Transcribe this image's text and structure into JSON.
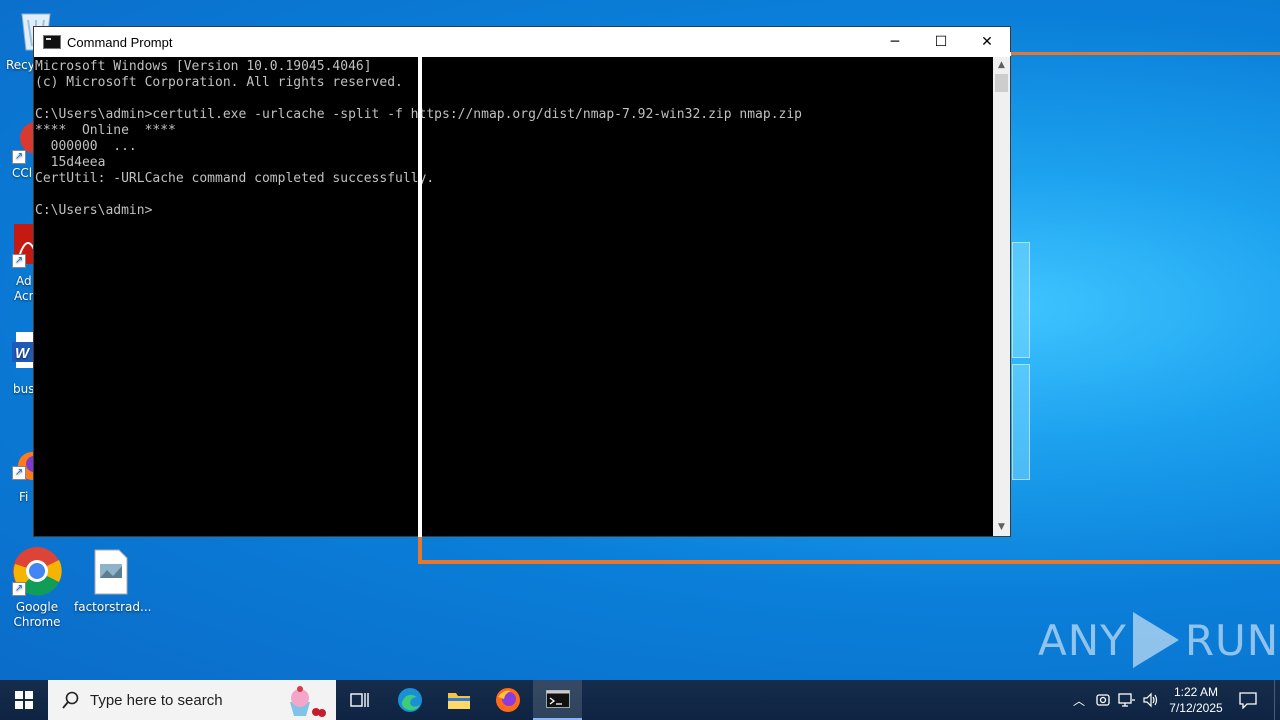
{
  "desktop": {
    "icons": [
      {
        "label": "Recy",
        "icon": "recycle-bin-icon"
      },
      {
        "label": "CCl",
        "icon": "ccleaner-icon"
      },
      {
        "label": "Ad\nAcr",
        "icon": "acrobat-icon"
      },
      {
        "label": "bus",
        "icon": "word-doc-icon"
      },
      {
        "label": "Fi",
        "icon": "firefox-icon"
      },
      {
        "label": "Google\nChrome",
        "icon": "chrome-icon"
      },
      {
        "label": "factorstrad...",
        "icon": "image-file-icon"
      }
    ]
  },
  "cmd": {
    "title": "Command Prompt",
    "minimize": "─",
    "maximize": "☐",
    "close": "✕",
    "output": "Microsoft Windows [Version 10.0.19045.4046]\n(c) Microsoft Corporation. All rights reserved.\n\nC:\\Users\\admin>certutil.exe -urlcache -split -f https://nmap.org/dist/nmap-7.92-win32.zip nmap.zip\n****  Online  ****\n  000000  ...\n  15d4eea\nCertUtil: -URLCache command completed successfully.\n\nC:\\Users\\admin>"
  },
  "watermark": {
    "left": "ANY",
    "right": "RUN"
  },
  "taskbar": {
    "search_placeholder": "Type here to search",
    "time": "1:22 AM",
    "date": "7/12/2025"
  },
  "colors": {
    "accent_orange": "#e8762c",
    "console_bg": "#000000",
    "console_text": "#c0c0c0"
  }
}
